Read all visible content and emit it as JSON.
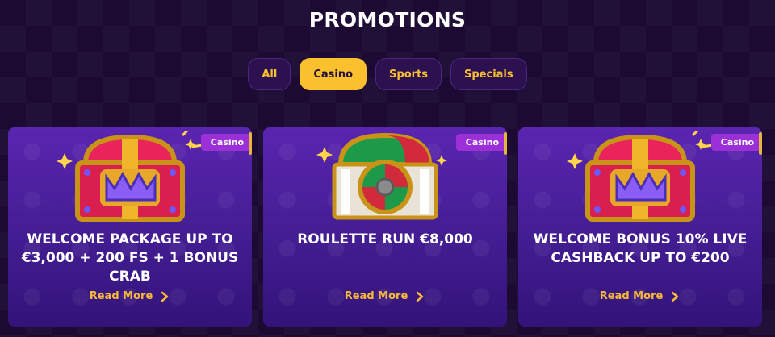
{
  "page": {
    "title": "PROMOTIONS"
  },
  "filters": [
    {
      "label": "All",
      "active": false
    },
    {
      "label": "Casino",
      "active": true
    },
    {
      "label": "Sports",
      "active": false
    },
    {
      "label": "Specials",
      "active": false
    }
  ],
  "cards": [
    {
      "badge": "Casino",
      "title": "WELCOME PACKAGE UP TO €3,000 + 200 FS + 1 BONUS CRAB",
      "cta": "Read More",
      "icon": "treasure-chest-crown-icon"
    },
    {
      "badge": "Casino",
      "title": "ROULETTE RUN €8,000",
      "cta": "Read More",
      "icon": "roulette-chest-icon"
    },
    {
      "badge": "Casino",
      "title": "WELCOME BONUS 10% LIVE CASHBACK UP TO €200",
      "cta": "Read More",
      "icon": "treasure-chest-crown-icon"
    }
  ],
  "colors": {
    "accent": "#fbc02d",
    "badge": "#9b30d8",
    "card": "#4a1f9a"
  }
}
